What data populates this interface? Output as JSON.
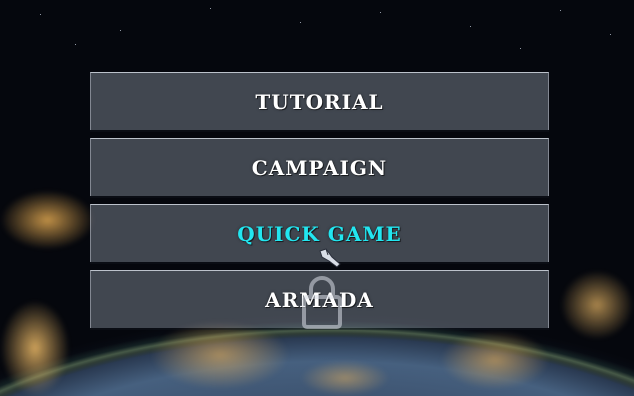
{
  "menu": {
    "items": [
      {
        "label": "TUTORIAL",
        "active": false,
        "locked": false
      },
      {
        "label": "CAMPAIGN",
        "active": false,
        "locked": false
      },
      {
        "label": "QUICK GAME",
        "active": true,
        "locked": false
      },
      {
        "label": "ARMADA",
        "active": false,
        "locked": true
      }
    ]
  },
  "icons": {
    "lock": "lock-icon",
    "cursor": "ship-cursor-icon"
  },
  "colors": {
    "active_text": "#22e6f0",
    "default_text": "#ffffff"
  }
}
